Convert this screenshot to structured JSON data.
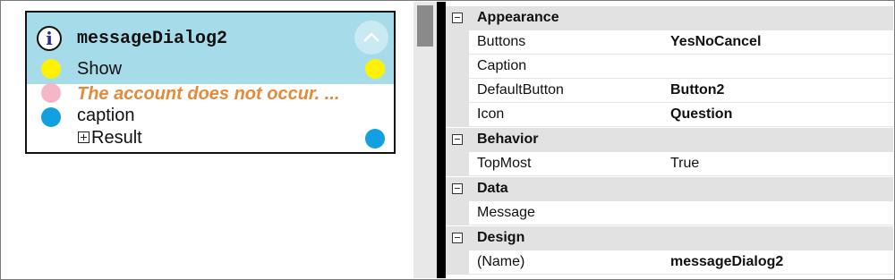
{
  "designer": {
    "node": {
      "icon": "info-icon",
      "title": "messageDialog2",
      "collapse_icon": "chevron-up-icon",
      "show_label": "Show",
      "message_text": "The account does not occur. ...",
      "caption_label": "caption",
      "result_label": "Result",
      "colors": {
        "header": "#a6dbe9",
        "trigger_port": "#fff200",
        "message_port": "#f7b6c8",
        "data_port": "#12a0e0",
        "message_text": "#e58a3a"
      }
    }
  },
  "properties": {
    "categories": [
      {
        "label": "Appearance",
        "items": [
          {
            "name": "Buttons",
            "value": "YesNoCancel"
          },
          {
            "name": "Caption",
            "value": ""
          },
          {
            "name": "DefaultButton",
            "value": "Button2"
          },
          {
            "name": "Icon",
            "value": "Question"
          }
        ]
      },
      {
        "label": "Behavior",
        "items": [
          {
            "name": "TopMost",
            "value": "True"
          }
        ]
      },
      {
        "label": "Data",
        "items": [
          {
            "name": "Message",
            "value": ""
          }
        ]
      },
      {
        "label": "Design",
        "items": [
          {
            "name": "(Name)",
            "value": "messageDialog2"
          }
        ]
      }
    ]
  }
}
